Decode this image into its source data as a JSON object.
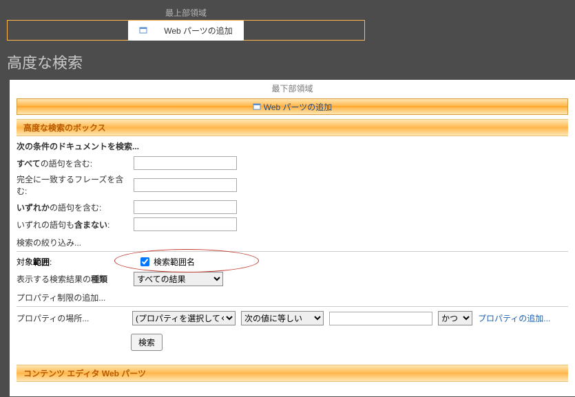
{
  "top_zone": {
    "label": "最上部領域",
    "add_button": "Web パーツの追加"
  },
  "page_title": "高度な検索",
  "bottom_zone": {
    "label": "最下部領域",
    "add_button": "Web パーツの追加"
  },
  "advanced_search": {
    "section_title": "高度な検索のボックス",
    "find_docs_label": "次の条件のドキュメントを検索...",
    "rows": {
      "all_words_pre": "すべて",
      "all_words_post": "の語句を含む:",
      "exact_phrase": "完全に一致するフレーズを含む:",
      "any_words_pre": "いずれか",
      "any_words_post": "の語句を含む:",
      "none_words_pre": "いずれの語句も",
      "none_words_bold": "含まない",
      "none_words_post": ":"
    },
    "values": {
      "all_words": "",
      "exact_phrase": "",
      "any_words": "",
      "none_words": ""
    },
    "narrow_label": "検索の絞り込み...",
    "scope": {
      "label_pre": "対象",
      "label_bold": "範囲",
      "label_post": ":",
      "checkbox_label": "検索範囲名",
      "checked": true
    },
    "result_type": {
      "label_pre": "表示する検索結果の",
      "label_bold": "種類",
      "selected": "すべての結果"
    },
    "property": {
      "heading": "プロパティ制限の追加...",
      "where_label": "プロパティの場所...",
      "select_prop": "(プロパティを選択してください)",
      "operator": "次の値に等しい",
      "value": "",
      "and_or": "かつ",
      "add_link": "プロパティの追加..."
    },
    "search_button": "検索"
  },
  "content_editor": {
    "title": "コンテンツ エディタ Web パーツ"
  }
}
